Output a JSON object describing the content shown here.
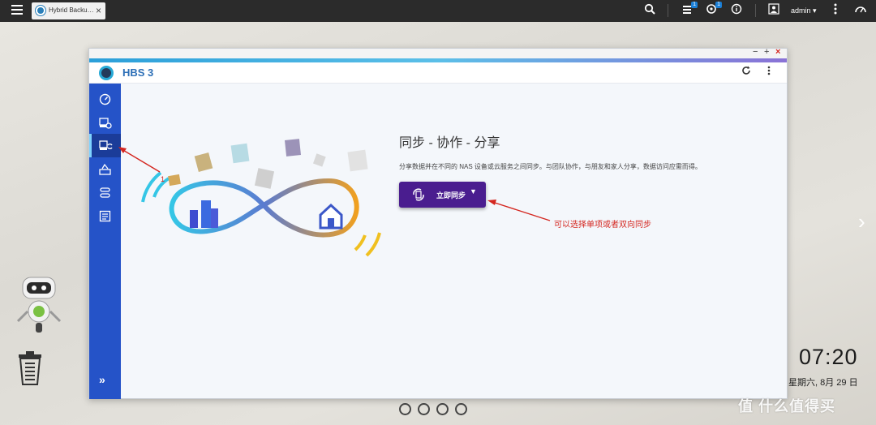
{
  "taskbar": {
    "tab_label": "Hybrid Backup ...",
    "tab_close": "×",
    "notify_badge_1": "1",
    "notify_badge_2": "1",
    "user_label": "admin ▾"
  },
  "window": {
    "app_title": "HBS 3",
    "ctrl_min": "−",
    "ctrl_max": "+",
    "ctrl_close": "×"
  },
  "sidebar": {
    "items": [
      {
        "icon": "dashboard-icon"
      },
      {
        "icon": "backup-restore-icon"
      },
      {
        "icon": "sync-icon",
        "active": true
      },
      {
        "icon": "services-icon"
      },
      {
        "icon": "storage-space-icon"
      },
      {
        "icon": "logs-icon"
      }
    ],
    "expand_label": "»"
  },
  "hero": {
    "title": "同步 - 协作 - 分享",
    "description": "分享数据并在不同的 NAS 设备或云服务之间同步。与团队协作，与朋友和家人分享，数据访问应需而得。",
    "sync_button_label": "立即同步",
    "sync_button_caret": "▼"
  },
  "annotations": {
    "arrow_label": "可以选择单项或者双向同步",
    "step_number": "1"
  },
  "desktop": {
    "clock": "07:20",
    "date": "星期六, 8月 29 日",
    "watermark": "值 什么值得买"
  },
  "colors": {
    "sidebar": "#2553c8",
    "sidebar_active": "#1b3c99",
    "accent_button": "#4a1d8f",
    "annotation": "#d4261f",
    "title": "#2c6fb7"
  }
}
